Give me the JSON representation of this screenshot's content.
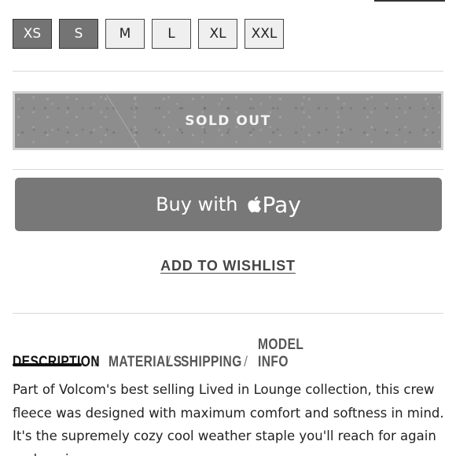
{
  "sizes": [
    {
      "label": "XS",
      "available": false
    },
    {
      "label": "S",
      "available": false
    },
    {
      "label": "M",
      "available": true
    },
    {
      "label": "L",
      "available": true
    },
    {
      "label": "XL",
      "available": true
    },
    {
      "label": "XXL",
      "available": true
    }
  ],
  "sold_out_label": "SOLD OUT",
  "apple_pay": {
    "buy_text": "Buy with",
    "pay_text": "Pay"
  },
  "wishlist_label": "ADD TO WISHLIST",
  "tabs": [
    "DESCRIPTION",
    "MATERIALS",
    "SHIPPING",
    "MODEL INFO"
  ],
  "tab_separator": "/",
  "description": "Part of Volcom's best selling Lived in Lounge collection, this crew fleece was designed with maximum comfort and softness in mind. It's the supremely cozy cool weather staple you'll reach for again and again."
}
